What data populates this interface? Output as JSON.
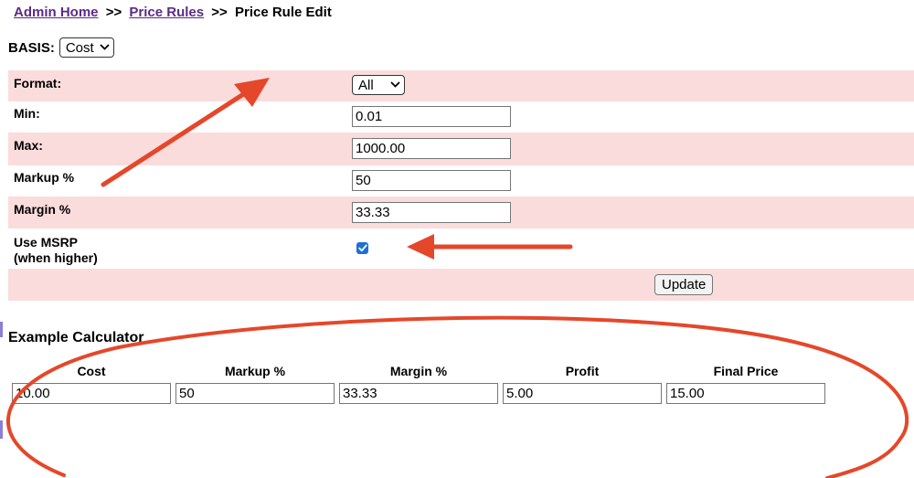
{
  "breadcrumb": {
    "home": "Admin Home",
    "sep1": ">>",
    "price_rules": "Price Rules",
    "sep2": ">>",
    "current": "Price Rule Edit"
  },
  "basis": {
    "label": "BASIS:",
    "selected": "Cost"
  },
  "form": {
    "format": {
      "label": "Format:",
      "selected": "All"
    },
    "min": {
      "label": "Min:",
      "value": "0.01"
    },
    "max": {
      "label": "Max:",
      "value": "1000.00"
    },
    "markup": {
      "label": "Markup %",
      "value": "50"
    },
    "margin": {
      "label": "Margin %",
      "value": "33.33"
    },
    "msrp": {
      "label_line1": "Use MSRP",
      "label_line2": "(when higher)",
      "checked": true
    },
    "update_label": "Update"
  },
  "calculator": {
    "title": "Example Calculator",
    "columns": [
      {
        "header": "Cost",
        "value": "10.00"
      },
      {
        "header": "Markup %",
        "value": "50"
      },
      {
        "header": "Margin %",
        "value": "33.33"
      },
      {
        "header": "Profit",
        "value": "5.00"
      },
      {
        "header": "Final Price",
        "value": "15.00"
      }
    ]
  },
  "colors": {
    "row_pink": "#fbdcdc",
    "link": "#5b2a86",
    "annotation_red": "#e5472a",
    "checkbox_blue": "#1f6fd6"
  },
  "icons": {
    "dropdown": "chevron-down-icon",
    "checkbox": "checkmark-icon",
    "annotation_arrows": "arrow-icon",
    "annotation_ellipse": "circle-annotation"
  }
}
